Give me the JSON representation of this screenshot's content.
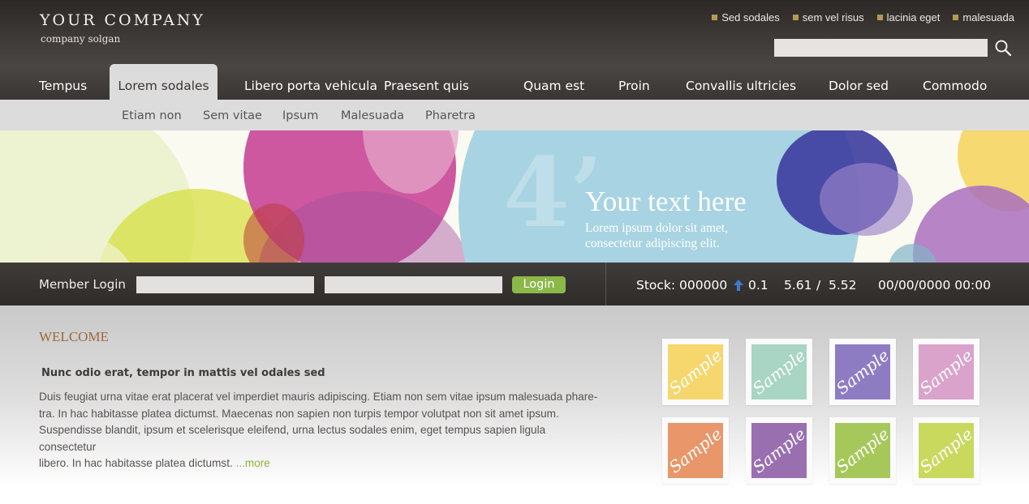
{
  "header": {
    "logo_title": "YOUR COMPANY",
    "logo_slogan": "company solgan",
    "top_links": [
      "Sed sodales",
      "sem vel risus",
      "lacinia eget",
      "malesuada"
    ],
    "search_placeholder": "",
    "accent_square_color": "#b39a52"
  },
  "nav": {
    "items": [
      "Tempus",
      "Lorem sodales",
      "Libero porta vehicula",
      "Praesent quis",
      "Quam est",
      "Proin",
      "Convallis ultricies",
      "Dolor sed",
      "Commodo"
    ],
    "active": "Lorem sodales",
    "sub_items": [
      "Etiam non",
      "Sem vitae",
      "Ipsum",
      "Malesuada",
      "Pharetra"
    ]
  },
  "banner": {
    "big_number": "4’",
    "heading": "Your text here",
    "subtext_line1": "Lorem ipsum dolor sit amet,",
    "subtext_line2": "consectetur adipiscing elit."
  },
  "login": {
    "label": "Member Login",
    "username_value": "",
    "password_value": "",
    "button_label": "Login",
    "button_color": "#8cb84a"
  },
  "stock": {
    "label": "Stock: 000000",
    "change": "0.1",
    "value1": "5.61",
    "separator": "/",
    "value2": "5.52",
    "datetime": "00/00/0000 00:00",
    "arrow_color": "#3a7ad0"
  },
  "content": {
    "welcome": "WELCOME",
    "subheading": "Nunc odio erat, tempor in mattis vel odales sed",
    "para_line1": "Duis feugiat urna vitae erat placerat vel imperdiet mauris adipiscing. Etiam non sem vitae ipsum malesuada phare-",
    "para_line2": "tra. In hac habitasse platea dictumst. Maecenas non sapien non turpis tempor volutpat non sit amet ipsum.",
    "para_line3": "Suspendisse blandit, ipsum et scelerisque eleifend, urna lectus sodales enim, eget tempus sapien ligula consectetur",
    "para_line4": "libero. In hac habitasse platea dictumst.",
    "more_link": "...more"
  },
  "samples": {
    "label": "Sample",
    "colors": [
      "#f5d76e",
      "#a8d5c4",
      "#8e7cc3",
      "#d9a3cc",
      "#e8966a",
      "#9a6fb0",
      "#a6c85a",
      "#c9d95e"
    ]
  }
}
